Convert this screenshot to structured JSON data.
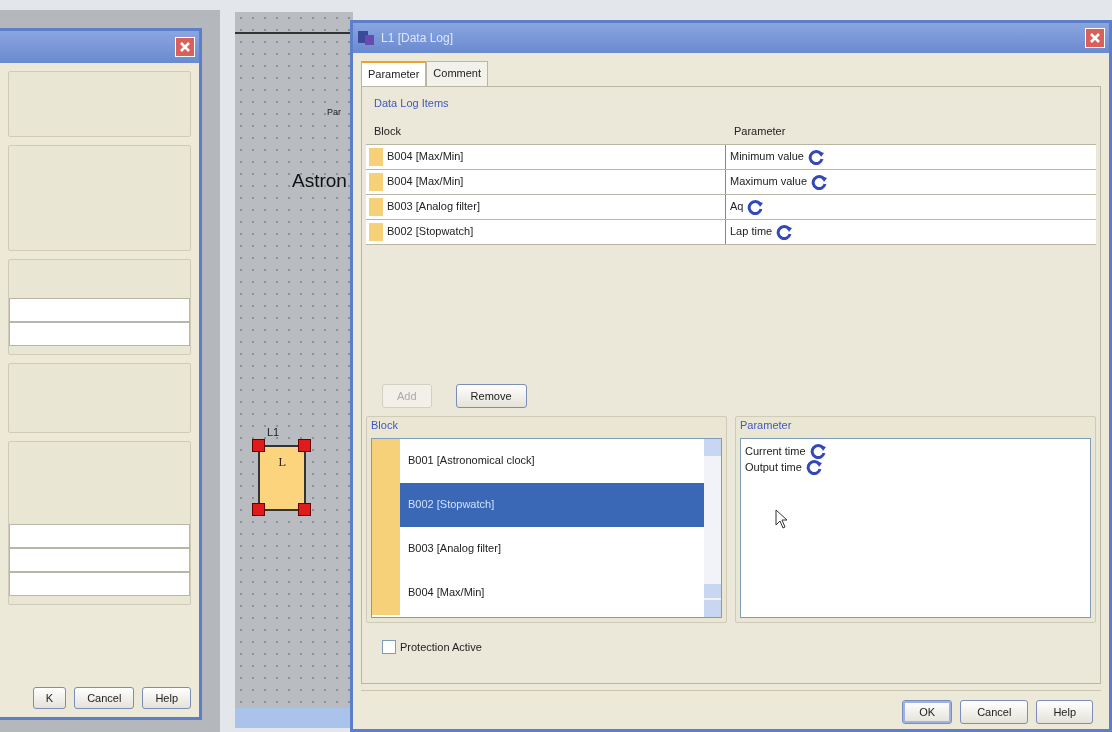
{
  "left_dialog": {
    "buttons": [
      {
        "label": "K"
      },
      {
        "label": "Cancel"
      },
      {
        "label": "Help"
      }
    ]
  },
  "canvas": {
    "connector_label": "Par",
    "block_title": "Astron",
    "block": {
      "name": "L1",
      "symbol": "L",
      "selected": true
    }
  },
  "dialog": {
    "title": "L1 [Data Log]",
    "tabs": [
      {
        "label": "Parameter",
        "selected": true
      },
      {
        "label": "Comment",
        "selected": false
      }
    ],
    "data_log_items": {
      "title": "Data Log Items",
      "columns": [
        "Block",
        "Parameter"
      ],
      "rows": [
        {
          "block": "B004 [Max/Min]",
          "parameter": "Minimum value"
        },
        {
          "block": "B004 [Max/Min]",
          "parameter": "Maximum value"
        },
        {
          "block": "B003 [Analog filter]",
          "parameter": "Aq"
        },
        {
          "block": "B002 [Stopwatch]",
          "parameter": "Lap time"
        }
      ]
    },
    "actions": [
      {
        "label": "Add",
        "disabled": true
      },
      {
        "label": "Remove",
        "disabled": false
      }
    ],
    "block_list": {
      "title": "Block",
      "items": [
        {
          "label": "B001 [Astronomical clock]",
          "selected": false
        },
        {
          "label": "B002 [Stopwatch]",
          "selected": true
        },
        {
          "label": "B003 [Analog filter]",
          "selected": false
        },
        {
          "label": "B004 [Max/Min]",
          "selected": false
        }
      ]
    },
    "parameter_list": {
      "title": "Parameter",
      "items": [
        {
          "label": "Current time"
        },
        {
          "label": "Output time"
        }
      ]
    },
    "protection": {
      "label": "Protection Active",
      "checked": false
    },
    "buttons": [
      {
        "label": "OK",
        "default": true
      },
      {
        "label": "Cancel",
        "default": false
      },
      {
        "label": "Help",
        "default": false
      }
    ]
  }
}
